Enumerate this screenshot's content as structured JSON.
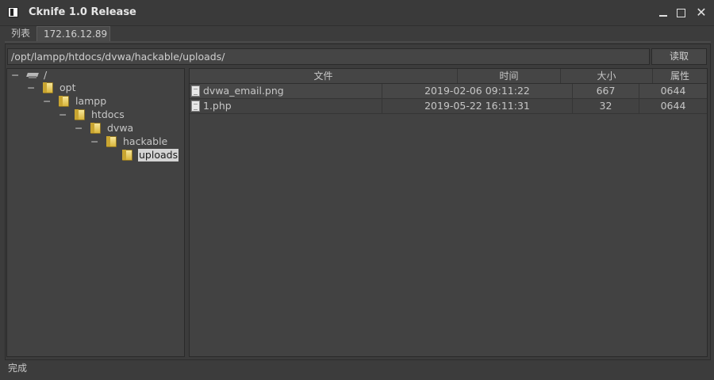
{
  "window": {
    "title": "Cknife 1.0 Release"
  },
  "tabs": [
    {
      "label": "列表"
    },
    {
      "label": "172.16.12.89"
    }
  ],
  "path": {
    "value": "/opt/lampp/htdocs/dvwa/hackable/uploads/"
  },
  "read_button": {
    "label": "读取"
  },
  "tree": {
    "nodes": [
      {
        "label": "/",
        "toggle": "−",
        "icon": "drive-icon"
      },
      {
        "label": "opt",
        "toggle": "−",
        "icon": "folder-icon"
      },
      {
        "label": "lampp",
        "toggle": "−",
        "icon": "folder-icon"
      },
      {
        "label": "htdocs",
        "toggle": "−",
        "icon": "folder-icon"
      },
      {
        "label": "dvwa",
        "toggle": "−",
        "icon": "folder-icon"
      },
      {
        "label": "hackable",
        "toggle": "−",
        "icon": "folder-icon"
      },
      {
        "label": "uploads",
        "toggle": "",
        "icon": "folder-icon",
        "selected": true
      }
    ]
  },
  "files": {
    "columns": [
      "文件",
      "时间",
      "大小",
      "属性"
    ],
    "rows": [
      {
        "name": "dvwa_email.png",
        "time": "2019-02-06 09:11:22",
        "size": "667",
        "attr": "0644"
      },
      {
        "name": "1.php",
        "time": "2019-05-22 16:11:31",
        "size": "32",
        "attr": "0644"
      }
    ]
  },
  "status": {
    "text": "完成"
  }
}
